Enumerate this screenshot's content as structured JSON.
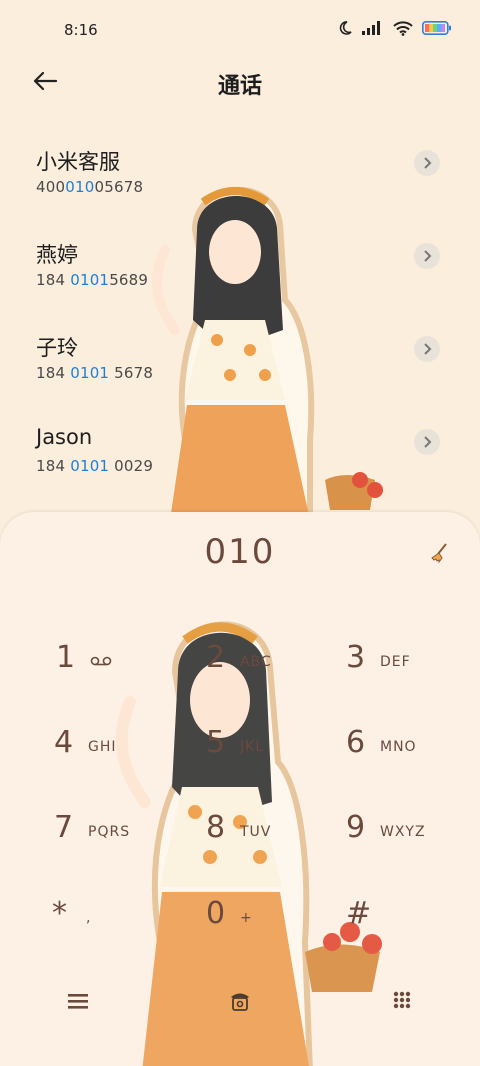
{
  "status": {
    "time": "8:16",
    "icons": [
      "moon-icon",
      "signal-icon",
      "wifi-icon",
      "battery-icon"
    ]
  },
  "header": {
    "title": "通话",
    "back_icon": "arrow-left-icon"
  },
  "results": [
    {
      "name": "小米客服",
      "num_pre": "400",
      "num_hl": "010",
      "num_post": "05678"
    },
    {
      "name": "燕婷",
      "num_pre": "184 ",
      "num_hl": "0101",
      "num_post": "5689"
    },
    {
      "name": "子玲",
      "num_pre": "184 ",
      "num_hl": "0101",
      "num_post": " 5678"
    },
    {
      "name": "Jason",
      "num_pre": "184 ",
      "num_hl": "0101",
      "num_post": " 0029"
    }
  ],
  "dialer": {
    "input": "010",
    "keys": [
      {
        "digit": "1",
        "letters": ""
      },
      {
        "digit": "2",
        "letters": "ABC"
      },
      {
        "digit": "3",
        "letters": "DEF"
      },
      {
        "digit": "4",
        "letters": "GHI"
      },
      {
        "digit": "5",
        "letters": "JKL"
      },
      {
        "digit": "6",
        "letters": "MNO"
      },
      {
        "digit": "7",
        "letters": "PQRS"
      },
      {
        "digit": "8",
        "letters": "TUV"
      },
      {
        "digit": "9",
        "letters": "WXYZ"
      },
      {
        "digit": "*",
        "letters": ","
      },
      {
        "digit": "0",
        "letters": "+"
      },
      {
        "digit": "#",
        "letters": ""
      }
    ]
  },
  "colors": {
    "background": "#fbeedd",
    "highlight": "#1d7fd9",
    "dial_text": "#6a4a3d"
  }
}
